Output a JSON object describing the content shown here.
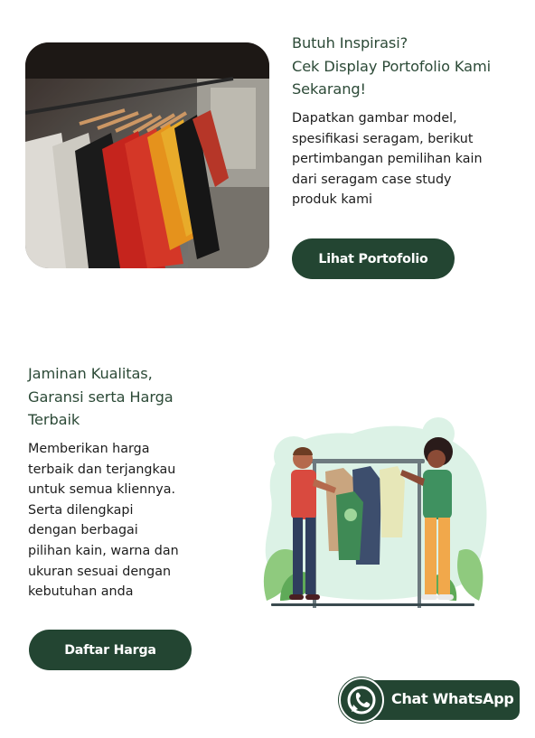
{
  "section1": {
    "title_lines": [
      "Butuh Inspirasi?",
      "Cek Display Portofolio Kami",
      "Sekarang!"
    ],
    "description_lines": [
      "Dapatkan gambar model,",
      "spesifikasi seragam, berikut",
      "pertimbangan pemilihan kain",
      "dari seragam case study",
      "produk kami"
    ],
    "button_label": "Lihat Portofolio"
  },
  "section2": {
    "title_lines": [
      "Jaminan Kualitas,",
      "Garansi serta Harga",
      "Terbaik"
    ],
    "description_lines": [
      "Memberikan harga",
      "terbaik dan terjangkau",
      "untuk semua kliennya.",
      "Serta dilengkapi",
      "dengan berbagai",
      "pilihan kain, warna dan",
      "ukuran sesuai dengan",
      "kebutuhan anda"
    ],
    "button_label": "Daftar Harga"
  },
  "whatsapp": {
    "label": "Chat WhatsApp",
    "icon": "whatsapp-icon"
  },
  "colors": {
    "primary": "#234532",
    "heading": "#2c4a37",
    "body_text": "#1c1c1c",
    "background": "#ffffff"
  }
}
